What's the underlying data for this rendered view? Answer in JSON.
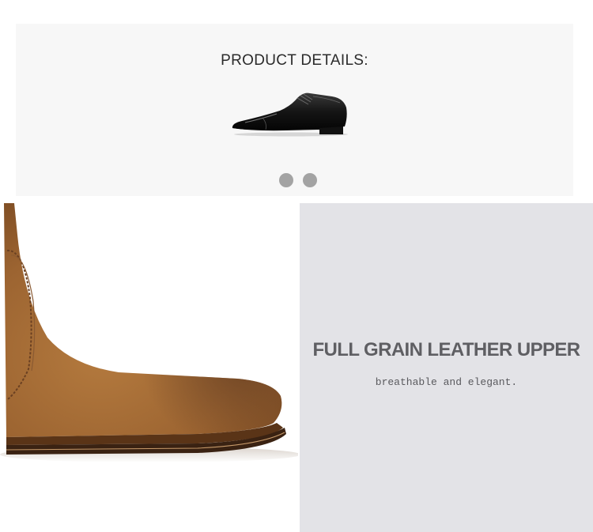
{
  "product_details": {
    "heading": "PRODUCT DETAILS:",
    "thumbnail_icon": "oxford-shoe-icon",
    "carousel": {
      "dot_count": 2,
      "dot_color": "#a3a3a3"
    }
  },
  "feature": {
    "title": "FULL GRAIN LEATHER UPPER",
    "subtitle": "breathable and elegant.",
    "image_icon": "suede-chelsea-boot-icon",
    "panel_color": "#e3e3e7"
  }
}
